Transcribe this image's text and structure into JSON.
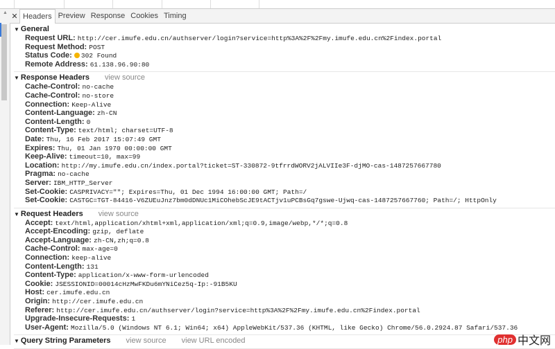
{
  "tabs": [
    "Headers",
    "Preview",
    "Response",
    "Cookies",
    "Timing"
  ],
  "general": {
    "title": "General",
    "rows": [
      [
        "Request URL:",
        "http://cer.imufe.edu.cn/authserver/login?service=http%3A%2F%2Fmy.imufe.edu.cn%2Findex.portal"
      ],
      [
        "Request Method:",
        "POST"
      ],
      [
        "Status Code:",
        "302 Found"
      ],
      [
        "Remote Address:",
        "61.138.96.90:80"
      ]
    ]
  },
  "response": {
    "title": "Response Headers",
    "view_source": "view source",
    "rows": [
      [
        "Cache-Control:",
        "no-cache"
      ],
      [
        "Cache-Control:",
        "no-store"
      ],
      [
        "Connection:",
        "Keep-Alive"
      ],
      [
        "Content-Language:",
        "zh-CN"
      ],
      [
        "Content-Length:",
        "0"
      ],
      [
        "Content-Type:",
        "text/html; charset=UTF-8"
      ],
      [
        "Date:",
        "Thu, 16 Feb 2017 15:07:49 GMT"
      ],
      [
        "Expires:",
        "Thu, 01 Jan 1970 00:00:00 GMT"
      ],
      [
        "Keep-Alive:",
        "timeout=10, max=99"
      ],
      [
        "Location:",
        "http://my.imufe.edu.cn/index.portal?ticket=ST-330872-9tfrrdWORV2jALVIIe3F-djMO-cas-1487257667780"
      ],
      [
        "Pragma:",
        "no-cache"
      ],
      [
        "Server:",
        "IBM_HTTP_Server"
      ],
      [
        "Set-Cookie:",
        "CASPRIVACY=\"\"; Expires=Thu, 01 Dec 1994 16:00:00 GMT; Path=/"
      ],
      [
        "Set-Cookie:",
        "CASTGC=TGT-84416-V6ZUEuJnz7bm0dDNUc1MiCOhebScJE9tACTjv1uPCBsGq7gswe-Ujwq-cas-1487257667760; Path=/; HttpOnly"
      ]
    ]
  },
  "request": {
    "title": "Request Headers",
    "view_source": "view source",
    "rows": [
      [
        "Accept:",
        "text/html,application/xhtml+xml,application/xml;q=0.9,image/webp,*/*;q=0.8"
      ],
      [
        "Accept-Encoding:",
        "gzip, deflate"
      ],
      [
        "Accept-Language:",
        "zh-CN,zh;q=0.8"
      ],
      [
        "Cache-Control:",
        "max-age=0"
      ],
      [
        "Connection:",
        "keep-alive"
      ],
      [
        "Content-Length:",
        "131"
      ],
      [
        "Content-Type:",
        "application/x-www-form-urlencoded"
      ],
      [
        "Cookie:",
        "JSESSIONID=00014cHzMwFKDu6mYNiCez5q-Ip:-91B5KU"
      ],
      [
        "Host:",
        "cer.imufe.edu.cn"
      ],
      [
        "Origin:",
        "http://cer.imufe.edu.cn"
      ],
      [
        "Referer:",
        "http://cer.imufe.edu.cn/authserver/login?service=http%3A%2F%2Fmy.imufe.edu.cn%2Findex.portal"
      ],
      [
        "Upgrade-Insecure-Requests:",
        "1"
      ],
      [
        "User-Agent:",
        "Mozilla/5.0 (Windows NT 6.1; Win64; x64) AppleWebKit/537.36 (KHTML, like Gecko) Chrome/56.0.2924.87 Safari/537.36"
      ]
    ]
  },
  "query": {
    "title": "Query String Parameters",
    "view_source": "view source",
    "view_url_encoded": "view URL encoded"
  },
  "watermark": {
    "php": "php",
    "text": "中文网"
  }
}
